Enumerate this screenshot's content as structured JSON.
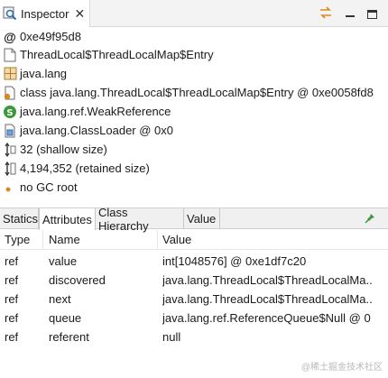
{
  "window": {
    "tab_label": "Inspector",
    "close_glyph": "✕"
  },
  "info_rows": [
    {
      "icon": "address-icon",
      "text": "0xe49f95d8"
    },
    {
      "icon": "class-file-icon",
      "text": "ThreadLocal$ThreadLocalMap$Entry"
    },
    {
      "icon": "package-icon",
      "text": "java.lang"
    },
    {
      "icon": "class-object-icon",
      "text": "class java.lang.ThreadLocal$ThreadLocalMap$Entry @ 0xe0058fd8"
    },
    {
      "icon": "superclass-icon",
      "text": "java.lang.ref.WeakReference"
    },
    {
      "icon": "classloader-icon",
      "text": "java.lang.ClassLoader @ 0x0"
    },
    {
      "icon": "shallow-size-icon",
      "text": "32 (shallow size)"
    },
    {
      "icon": "retained-size-icon",
      "text": "4,194,352 (retained size)"
    },
    {
      "icon": "gc-root-dot-icon",
      "text": "no GC root"
    }
  ],
  "tabs": [
    "Statics",
    "Attributes",
    "Class Hierarchy",
    "Value"
  ],
  "active_tab": "Attributes",
  "table": {
    "headers": [
      "Type",
      "Name",
      "Value"
    ],
    "rows": [
      [
        "ref",
        "value",
        "int[1048576] @ 0xe1df7c20"
      ],
      [
        "ref",
        "discovered",
        "java.lang.ThreadLocal$ThreadLocalMa..."
      ],
      [
        "ref",
        "next",
        "java.lang.ThreadLocal$ThreadLocalMa..."
      ],
      [
        "ref",
        "queue",
        "java.lang.ref.ReferenceQueue$Null @ 0..."
      ],
      [
        "ref",
        "referent",
        "null"
      ]
    ]
  },
  "watermark": "@稀土掘金技术社区",
  "colors": {
    "accent_green": "#3a9a3a",
    "accent_orange": "#d98a1f",
    "icon_blue": "#2d6db5"
  }
}
